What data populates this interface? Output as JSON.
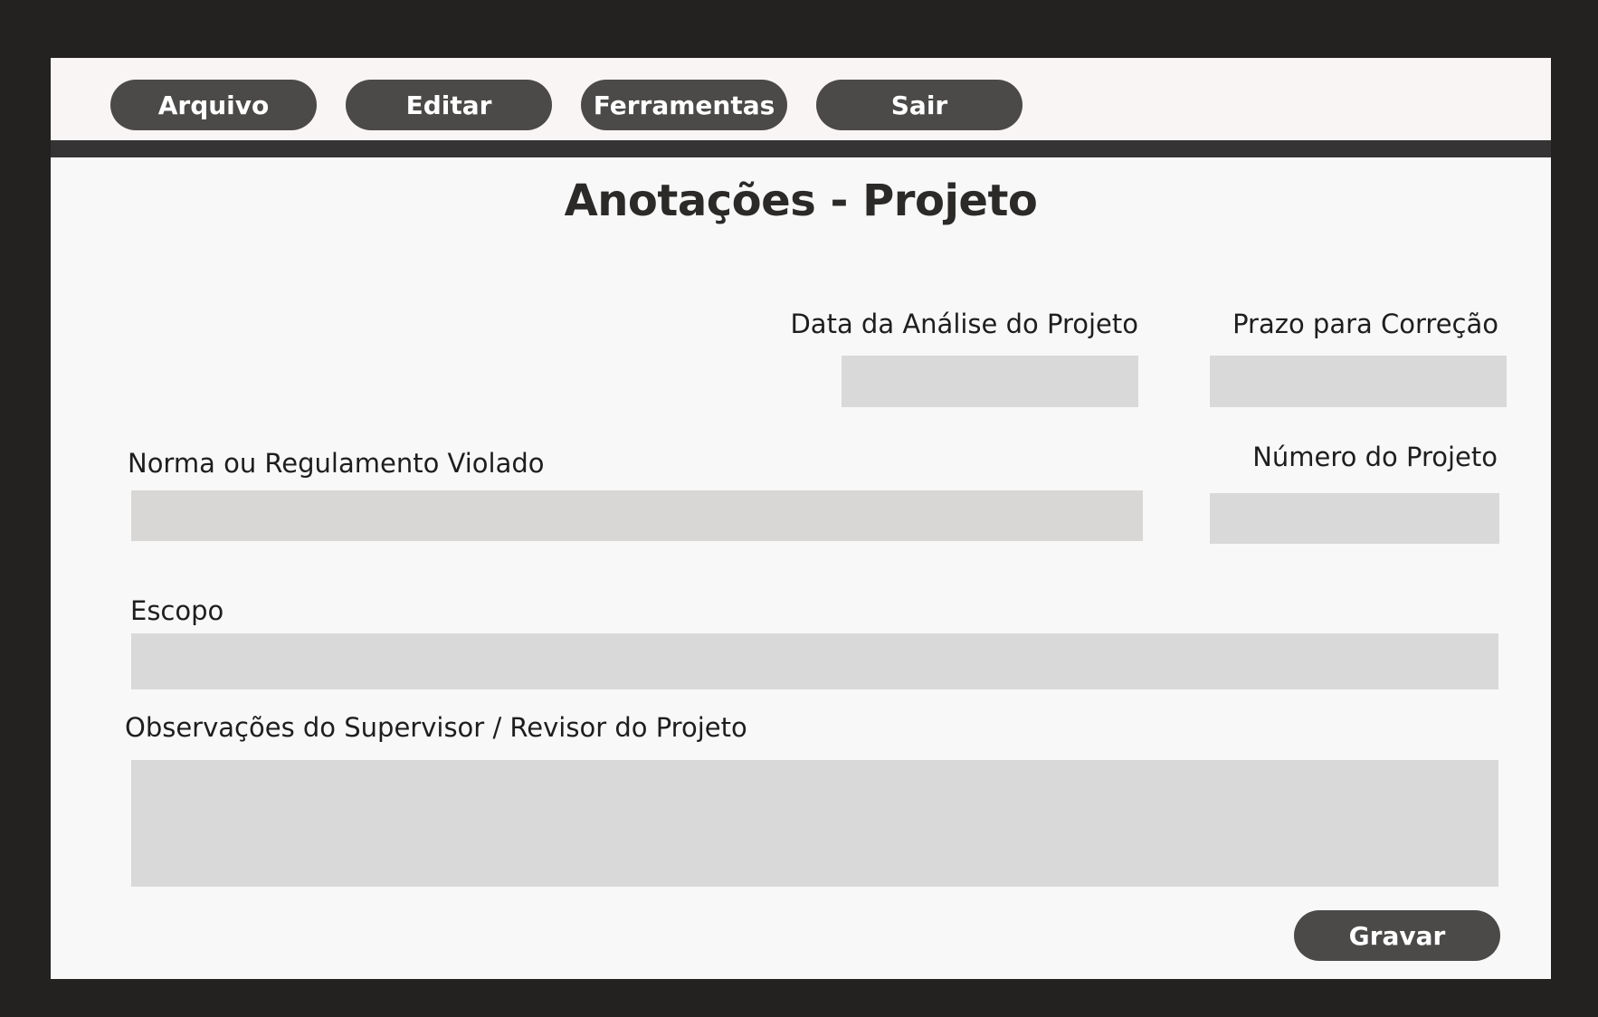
{
  "menu": {
    "items": [
      {
        "label": "Arquivo"
      },
      {
        "label": "Editar"
      },
      {
        "label": "Ferramentas"
      },
      {
        "label": "Sair"
      }
    ]
  },
  "page": {
    "title": "Anotações - Projeto"
  },
  "form": {
    "analysis_date": {
      "label": "Data da Análise do Projeto",
      "value": ""
    },
    "correction_deadline": {
      "label": "Prazo para Correção",
      "value": ""
    },
    "violated_rule": {
      "label": "Norma ou Regulamento Violado",
      "value": ""
    },
    "project_number": {
      "label": "Número do Projeto",
      "value": ""
    },
    "scope": {
      "label": "Escopo",
      "value": ""
    },
    "supervisor_notes": {
      "label": "Observações do Supervisor / Revisor do Projeto",
      "value": ""
    }
  },
  "actions": {
    "save_label": "Gravar"
  },
  "colors": {
    "frame": "#232221",
    "window_bg": "#f8f8f8",
    "menubar_bg": "#f8f5f4",
    "button_bg": "#4b4a49",
    "divider": "#353333",
    "field_bg": "#d9d9d9"
  }
}
